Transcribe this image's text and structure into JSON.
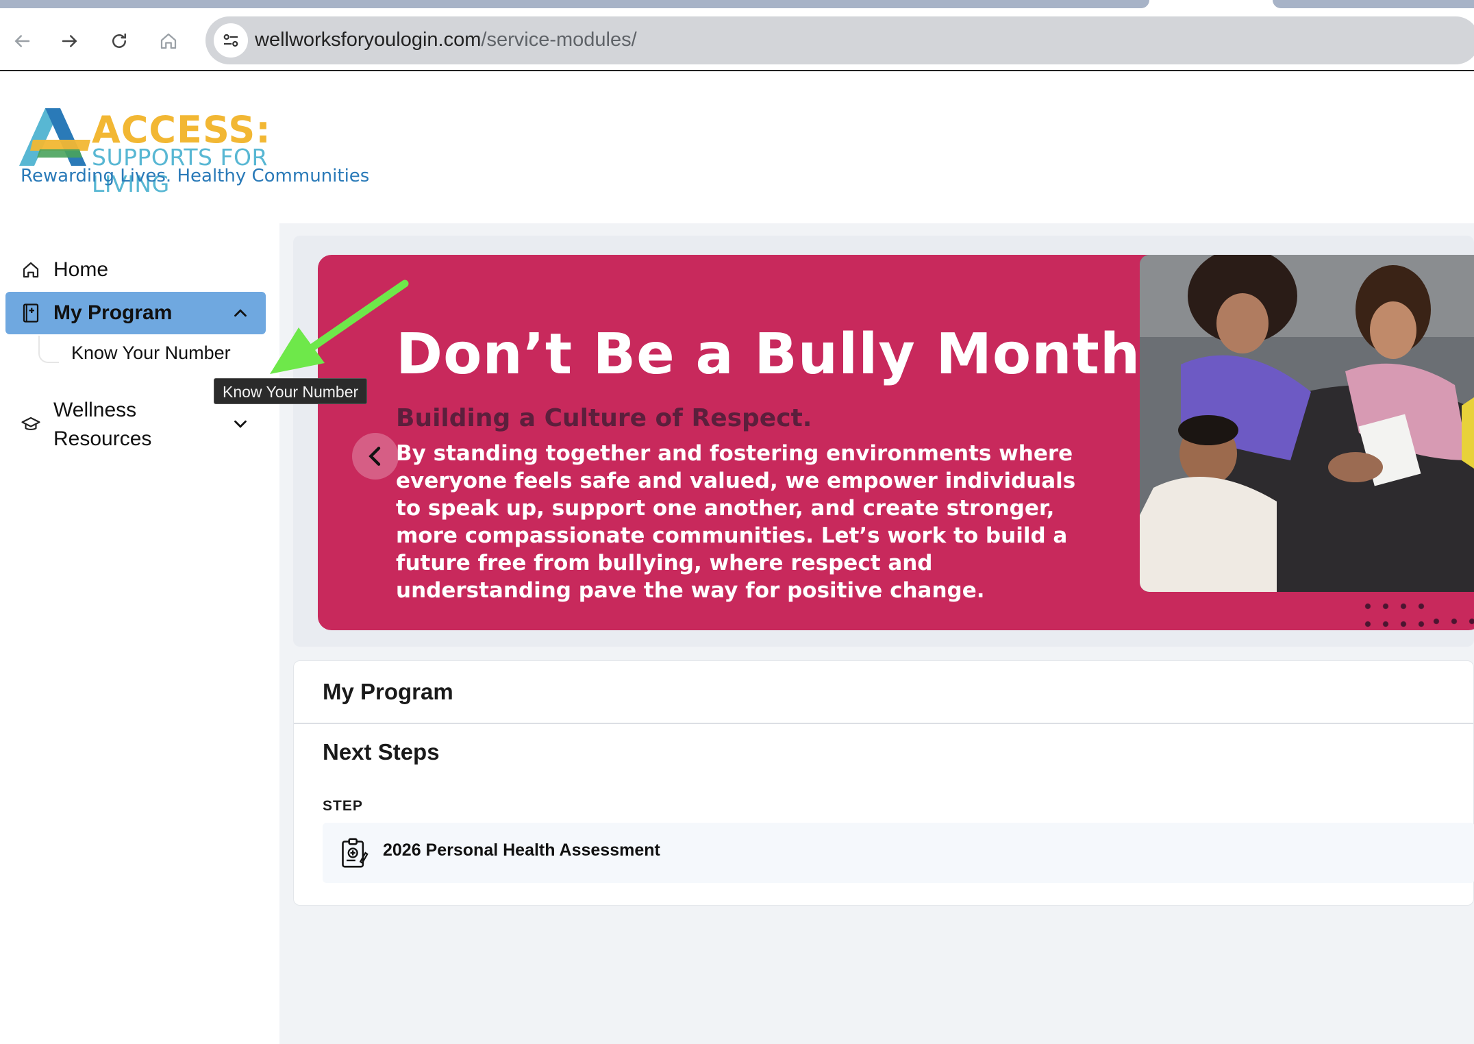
{
  "browser": {
    "url_domain": "wellworksforyoulogin.com",
    "url_path": "/service-modules/"
  },
  "logo": {
    "word": "ACCESS:",
    "sub": "SUPPORTS FOR LIVING",
    "tagline": "Rewarding Lives. Healthy Communities",
    "colors": {
      "yellow": "#f2b733",
      "blue": "#58b7d3",
      "dark_blue": "#2a7ab8"
    }
  },
  "sidebar": {
    "home": "Home",
    "my_program": "My Program",
    "my_program_sub": "Know Your Number",
    "wellness_line1": "Wellness",
    "wellness_line2": "Resources",
    "active_color": "#6fa8e0"
  },
  "tooltip": "Know Your Number",
  "banner": {
    "title": "Don’t Be a Bully Month",
    "subtitle": "Building a Culture of Respect.",
    "body": "By standing together and fostering environments where everyone feels safe and valued, we empower individuals to speak up, support one another, and create stronger, more compassionate communities. Let’s work to build a future free from bullying, where respect and understanding pave the way for positive change.",
    "bg_color": "#c8295c"
  },
  "program_card": {
    "title": "My Program",
    "next_steps": "Next Steps",
    "step_label": "STEP",
    "step_item": "2026 Personal Health Assessment"
  },
  "annotation_arrow_color": "#6ee84a"
}
